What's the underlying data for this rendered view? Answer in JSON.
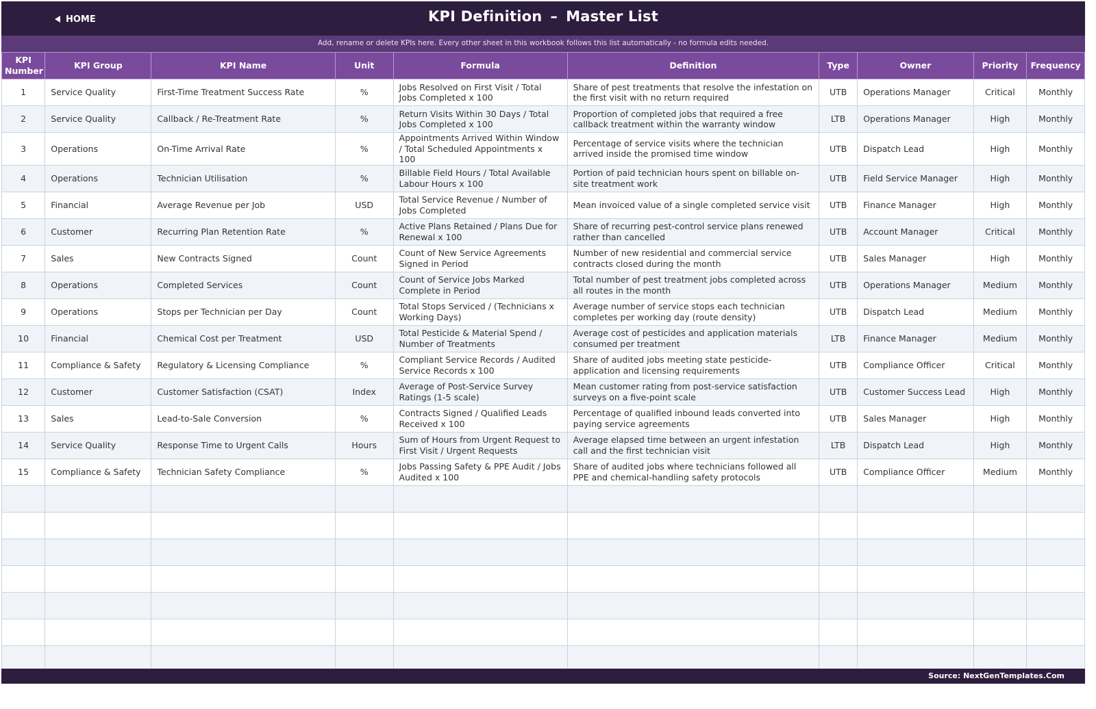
{
  "header": {
    "home_label": "HOME",
    "title_left": "KPI Definition",
    "title_sep": "–",
    "title_right": "Master List",
    "subtitle": "Add, rename or delete KPIs here. Every other sheet in this workbook follows this list automatically - no formula edits needed."
  },
  "columns": [
    "KPI Number",
    "KPI Group",
    "KPI Name",
    "Unit",
    "Formula",
    "Definition",
    "Type",
    "Owner",
    "Priority",
    "Frequency"
  ],
  "rows": [
    [
      "1",
      "Service Quality",
      "First-Time Treatment Success Rate",
      "%",
      "Jobs Resolved on First Visit / Total Jobs Completed x 100",
      "Share of pest treatments that resolve the infestation on the first visit with no return required",
      "UTB",
      "Operations Manager",
      "Critical",
      "Monthly"
    ],
    [
      "2",
      "Service Quality",
      "Callback / Re-Treatment Rate",
      "%",
      "Return Visits Within 30 Days / Total Jobs Completed x 100",
      "Proportion of completed jobs that required a free callback treatment within the warranty window",
      "LTB",
      "Operations Manager",
      "High",
      "Monthly"
    ],
    [
      "3",
      "Operations",
      "On-Time Arrival Rate",
      "%",
      "Appointments Arrived Within Window / Total Scheduled Appointments x 100",
      "Percentage of service visits where the technician arrived inside the promised time window",
      "UTB",
      "Dispatch Lead",
      "High",
      "Monthly"
    ],
    [
      "4",
      "Operations",
      "Technician Utilisation",
      "%",
      "Billable Field Hours / Total Available Labour Hours x 100",
      "Portion of paid technician hours spent on billable on-site treatment work",
      "UTB",
      "Field Service Manager",
      "High",
      "Monthly"
    ],
    [
      "5",
      "Financial",
      "Average Revenue per Job",
      "USD",
      "Total Service Revenue / Number of Jobs Completed",
      "Mean invoiced value of a single completed service visit",
      "UTB",
      "Finance Manager",
      "High",
      "Monthly"
    ],
    [
      "6",
      "Customer",
      "Recurring Plan Retention Rate",
      "%",
      "Active Plans Retained / Plans Due for Renewal x 100",
      "Share of recurring pest-control service plans renewed rather than cancelled",
      "UTB",
      "Account Manager",
      "Critical",
      "Monthly"
    ],
    [
      "7",
      "Sales",
      "New Contracts Signed",
      "Count",
      "Count of New Service Agreements Signed in Period",
      "Number of new residential and commercial service contracts closed during the month",
      "UTB",
      "Sales Manager",
      "High",
      "Monthly"
    ],
    [
      "8",
      "Operations",
      "Completed Services",
      "Count",
      "Count of Service Jobs Marked Complete in Period",
      "Total number of pest treatment jobs completed across all routes in the month",
      "UTB",
      "Operations Manager",
      "Medium",
      "Monthly"
    ],
    [
      "9",
      "Operations",
      "Stops per Technician per Day",
      "Count",
      "Total Stops Serviced / (Technicians x Working Days)",
      "Average number of service stops each technician completes per working day (route density)",
      "UTB",
      "Dispatch Lead",
      "Medium",
      "Monthly"
    ],
    [
      "10",
      "Financial",
      "Chemical Cost per Treatment",
      "USD",
      "Total Pesticide & Material Spend / Number of Treatments",
      "Average cost of pesticides and application materials consumed per treatment",
      "LTB",
      "Finance Manager",
      "Medium",
      "Monthly"
    ],
    [
      "11",
      "Compliance & Safety",
      "Regulatory & Licensing Compliance",
      "%",
      "Compliant Service Records / Audited Service Records x 100",
      "Share of audited jobs meeting state pesticide-application and licensing requirements",
      "UTB",
      "Compliance Officer",
      "Critical",
      "Monthly"
    ],
    [
      "12",
      "Customer",
      "Customer Satisfaction (CSAT)",
      "Index",
      "Average of Post-Service Survey Ratings (1-5 scale)",
      "Mean customer rating from post-service satisfaction surveys on a five-point scale",
      "UTB",
      "Customer Success Lead",
      "High",
      "Monthly"
    ],
    [
      "13",
      "Sales",
      "Lead-to-Sale Conversion",
      "%",
      "Contracts Signed / Qualified Leads Received x 100",
      "Percentage of qualified inbound leads converted into paying service agreements",
      "UTB",
      "Sales Manager",
      "High",
      "Monthly"
    ],
    [
      "14",
      "Service Quality",
      "Response Time to Urgent Calls",
      "Hours",
      "Sum of Hours from Urgent Request to First Visit / Urgent Requests",
      "Average elapsed time between an urgent infestation call and the first technician visit",
      "LTB",
      "Dispatch Lead",
      "High",
      "Monthly"
    ],
    [
      "15",
      "Compliance & Safety",
      "Technician Safety Compliance",
      "%",
      "Jobs Passing Safety & PPE Audit / Jobs Audited x 100",
      "Share of audited jobs where technicians followed all PPE and chemical-handling safety protocols",
      "UTB",
      "Compliance Officer",
      "Medium",
      "Monthly"
    ]
  ],
  "footer": {
    "source": "Source: NextGenTemplates.Com"
  }
}
